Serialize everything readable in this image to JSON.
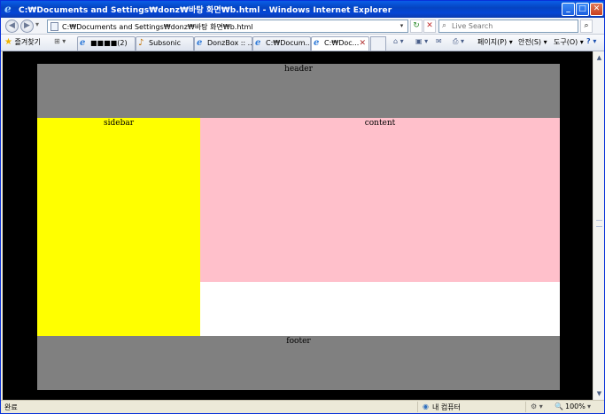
{
  "window": {
    "title": "C:₩Documents and Settings₩donz₩바탕 화면₩b.html - Windows Internet Explorer",
    "min_glyph": "_",
    "max_glyph": "□",
    "close_glyph": "✕"
  },
  "address_bar": {
    "url": "C:₩Documents and Settings₩donz₩바탕 화면₩b.html",
    "refresh_glyph": "↻",
    "stop_glyph": "✕"
  },
  "search": {
    "placeholder": "Live Search",
    "go_glyph": "⌕"
  },
  "toolbar": {
    "favorites_label": "즐겨찾기",
    "tab_count_label": "(2)",
    "tabs": [
      {
        "label": "■■■■(2)",
        "icon": "ie-page-icon"
      },
      {
        "label": "Subsonic",
        "icon": "subsonic-icon"
      },
      {
        "label": "DonzBox :: ...",
        "icon": "ie-page-icon"
      },
      {
        "label": "C:₩Docum...",
        "icon": "ie-page-icon"
      },
      {
        "label": "C:₩Doc...",
        "icon": "ie-page-icon",
        "active": true
      }
    ],
    "commands": {
      "page_label": "페이지(P)",
      "safety_label": "안전(S)",
      "tools_label": "도구(O)",
      "help_glyph": "?"
    }
  },
  "page": {
    "header_label": "header",
    "sidebar_label": "sidebar",
    "content_label": "content",
    "footer_label": "footer",
    "colors": {
      "background": "#000000",
      "header": "#808080",
      "sidebar": "#ffff00",
      "content": "#ffc0cb",
      "blank": "#ffffff",
      "footer": "#808080"
    }
  },
  "status_bar": {
    "status_text": "완료",
    "zone_text": "내 컴퓨터",
    "zoom_text": "100%"
  }
}
